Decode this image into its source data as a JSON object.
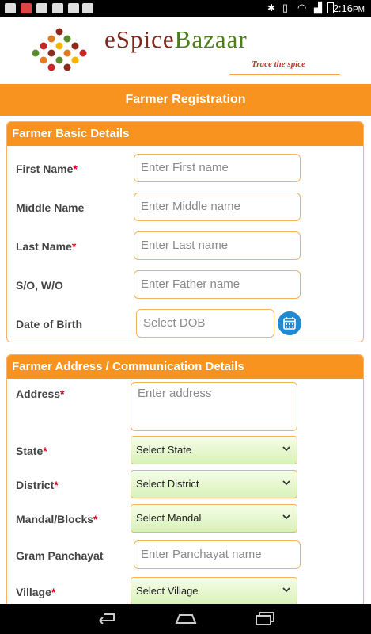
{
  "status": {
    "time": "2:16",
    "ampm": "PM"
  },
  "brand": {
    "name_part1": "eSpice",
    "name_part2": "Bazaar",
    "tagline": "Trace the spice"
  },
  "page_title": "Farmer Registration",
  "basic": {
    "title": "Farmer Basic Details",
    "first_name": {
      "label": "First Name",
      "required": "*",
      "placeholder": "Enter First name"
    },
    "middle_name": {
      "label": "Middle Name",
      "placeholder": "Enter Middle name"
    },
    "last_name": {
      "label": "Last Name",
      "required": "*",
      "placeholder": "Enter Last name"
    },
    "so_wo": {
      "label": "S/O, W/O",
      "placeholder": "Enter Father name"
    },
    "dob": {
      "label": "Date of Birth",
      "placeholder": "Select DOB"
    }
  },
  "address": {
    "title": "Farmer Address / Communication Details",
    "address": {
      "label": "Address",
      "required": "*",
      "placeholder": "Enter address"
    },
    "state": {
      "label": "State",
      "required": "*",
      "value": "Select State"
    },
    "district": {
      "label": "District",
      "required": "*",
      "value": "Select District"
    },
    "mandal": {
      "label": "Mandal/Blocks",
      "required": "*",
      "value": "Select Mandal"
    },
    "gram": {
      "label": "Gram Panchayat",
      "placeholder": "Enter Panchayat name"
    },
    "village": {
      "label": "Village",
      "required": "*",
      "value": "Select Village"
    }
  },
  "colors": {
    "accent": "#f7931e",
    "required": "#d0021b",
    "select_bg": "#d8f2b7",
    "calendar": "#1f8ad1"
  },
  "icons": {
    "calendar": "calendar-icon",
    "dropdown": "chevron-down-icon",
    "back": "back-icon",
    "home": "home-icon",
    "recents": "recents-icon"
  }
}
